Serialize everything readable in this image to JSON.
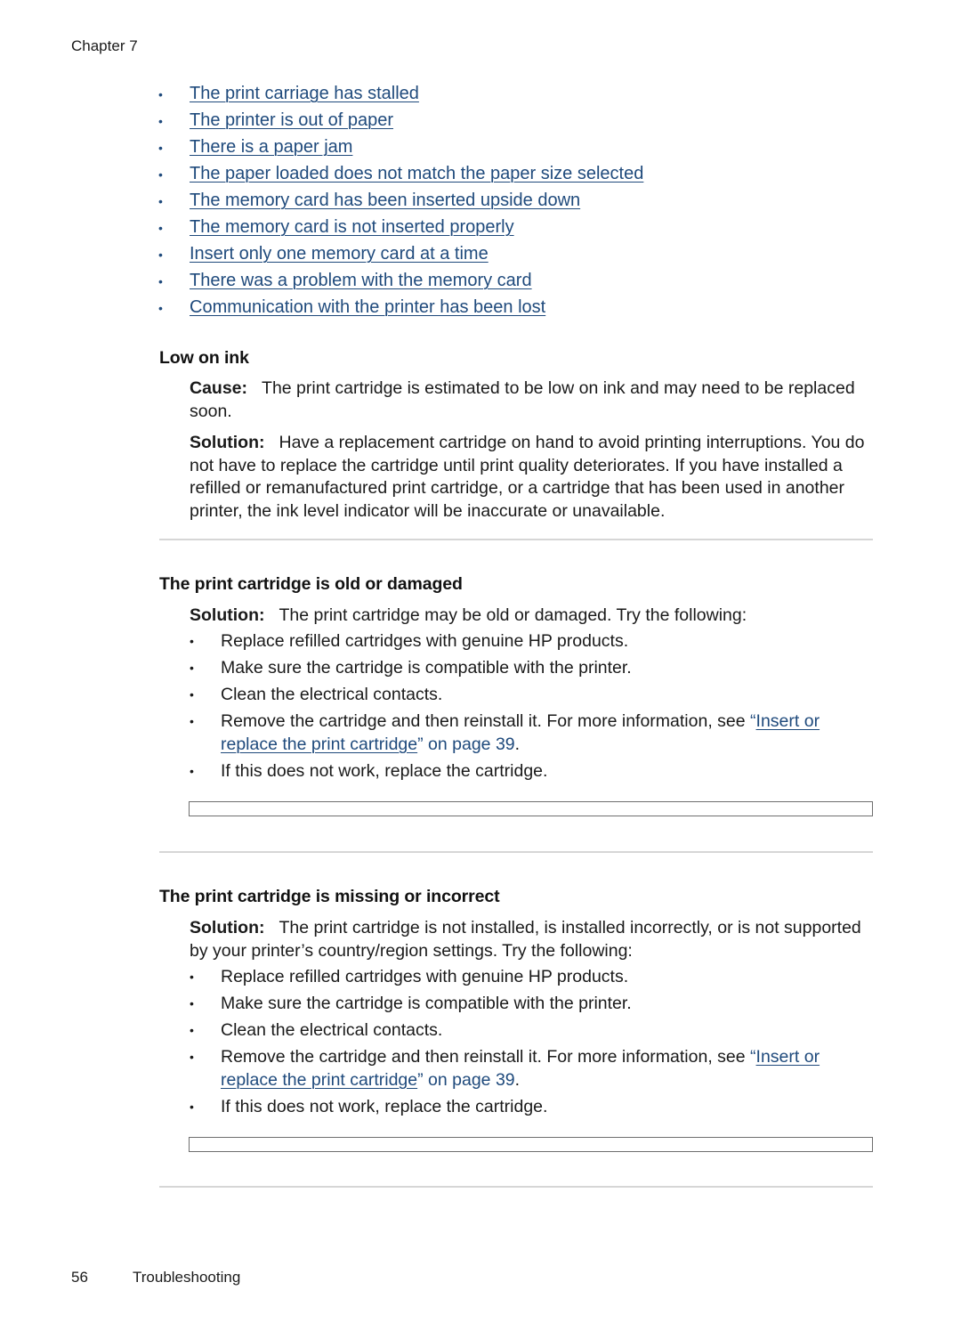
{
  "header": {
    "chapter": "Chapter 7"
  },
  "toc_links": [
    "The print carriage has stalled",
    "The printer is out of paper",
    "There is a paper jam",
    "The paper loaded does not match the paper size selected",
    "The memory card has been inserted upside down",
    "The memory card is not inserted properly",
    "Insert only one memory card at a time",
    "There was a problem with the memory card",
    "Communication with the printer has been lost"
  ],
  "sections": [
    {
      "title": "Low on ink",
      "cause_label": "Cause:",
      "cause_text": "The print cartridge is estimated to be low on ink and may need to be replaced soon.",
      "solution_label": "Solution:",
      "solution_text": "Have a replacement cartridge on hand to avoid printing interruptions. You do not have to replace the cartridge until print quality deteriorates. If you have installed a refilled or remanufactured print cartridge, or a cartridge that has been used in another printer, the ink level indicator will be inaccurate or unavailable."
    },
    {
      "title": "The print cartridge is old or damaged",
      "solution_label": "Solution:",
      "solution_text": "The print cartridge may be old or damaged. Try the following:",
      "bullets": [
        "Replace refilled cartridges with genuine HP products.",
        "Make sure the cartridge is compatible with the printer.",
        "Clean the electrical contacts.",
        "If this does not work, replace the cartridge."
      ],
      "ref_bullet": {
        "prefix": "Remove the cartridge and then reinstall it. For more information, see ",
        "open_quote": "“",
        "link": "Insert or replace the print cartridge",
        "tail": "” on page 39",
        "end": "."
      }
    },
    {
      "title": "The print cartridge is missing or incorrect",
      "solution_label": "Solution:",
      "solution_text": "The print cartridge is not installed, is installed incorrectly, or is not supported by your printer’s country/region settings. Try the following:",
      "bullets": [
        "Replace refilled cartridges with genuine HP products.",
        "Make sure the cartridge is compatible with the printer.",
        "Clean the electrical contacts.",
        "If this does not work, replace the cartridge."
      ],
      "ref_bullet": {
        "prefix": "Remove the cartridge and then reinstall it. For more information, see ",
        "open_quote": "“",
        "link": "Insert or replace the print cartridge",
        "tail": "” on page 39",
        "end": "."
      }
    }
  ],
  "footer": {
    "page_number": "56",
    "section": "Troubleshooting"
  },
  "bullet_glyph": "•",
  "colors": {
    "link": "#1f4a7c",
    "text": "#1a1a1a",
    "rule": "#d6d6d6"
  }
}
